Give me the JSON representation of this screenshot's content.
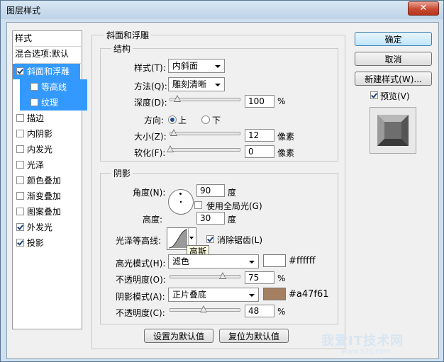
{
  "window": {
    "title": "图层样式",
    "close": "✕"
  },
  "left_list": {
    "header": "样式",
    "blend_options": "混合选项:默认",
    "items": [
      {
        "label": "斜面和浮雕",
        "checked": true,
        "selected": true
      },
      {
        "label": "等高线",
        "checked": false,
        "selected": true
      },
      {
        "label": "纹理",
        "checked": false,
        "selected": true
      },
      {
        "label": "描边",
        "checked": false
      },
      {
        "label": "内阴影",
        "checked": false
      },
      {
        "label": "内发光",
        "checked": false
      },
      {
        "label": "光泽",
        "checked": false
      },
      {
        "label": "颜色叠加",
        "checked": false
      },
      {
        "label": "渐变叠加",
        "checked": false
      },
      {
        "label": "图案叠加",
        "checked": false
      },
      {
        "label": "外发光",
        "checked": true
      },
      {
        "label": "投影",
        "checked": true
      }
    ]
  },
  "bevel": {
    "title": "斜面和浮雕",
    "structure_title": "结构",
    "style_label": "样式(T):",
    "style_value": "内斜面",
    "technique_label": "方法(Q):",
    "technique_value": "雕刻清晰",
    "depth_label": "深度(D):",
    "depth_value": "100",
    "depth_unit": "%",
    "depth_level": 0.1,
    "direction_label": "方向:",
    "dir_up": "上",
    "dir_down": "下",
    "size_label": "大小(Z):",
    "size_value": "12",
    "size_unit": "像素",
    "size_level": 0.05,
    "soften_label": "软化(F):",
    "soften_value": "0",
    "soften_unit": "像素",
    "soften_level": 0.0
  },
  "shading": {
    "title": "阴影",
    "angle_label": "角度(N):",
    "angle_value": "90",
    "angle_unit": "度",
    "global_light": "使用全局光(G)",
    "altitude_label": "高度:",
    "altitude_value": "30",
    "altitude_unit": "度",
    "gloss_label": "光泽等高线:",
    "antialias": "消除锯齿(L)",
    "tooltip": "高斯",
    "highlight_label": "高光模式(H):",
    "highlight_value": "滤色",
    "highlight_color": "#ffffff",
    "highlight_hex": "#ffffff",
    "hl_opacity_label": "不透明度(O):",
    "hl_opacity_value": "75",
    "hl_opacity_unit": "%",
    "hl_opacity_level": 0.75,
    "shadow_label": "阴影模式(A):",
    "shadow_value": "正片叠底",
    "shadow_color": "#a47f61",
    "shadow_hex": "#a47f61",
    "sh_opacity_label": "不透明度(C):",
    "sh_opacity_value": "48",
    "sh_opacity_unit": "%",
    "sh_opacity_level": 0.48
  },
  "footer": {
    "set_default": "设置为默认值",
    "reset_default": "复位为默认值"
  },
  "right": {
    "ok": "确定",
    "cancel": "取消",
    "new_style": "新建样式(W)...",
    "preview": "预览(V)"
  },
  "watermark": {
    "text": "我爱IT技术网",
    "url": "www.52ij.com"
  }
}
